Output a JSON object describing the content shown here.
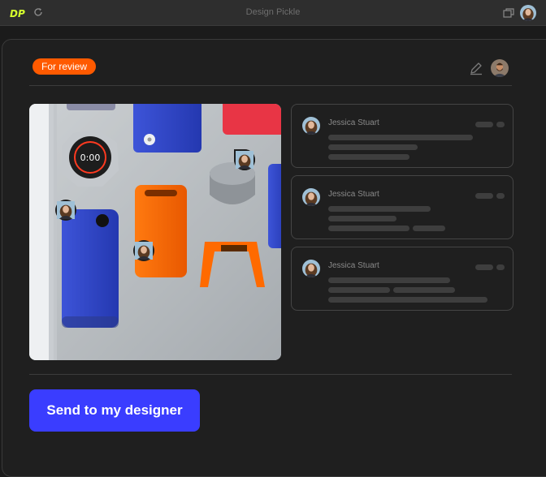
{
  "app": {
    "title": "Design Pickle",
    "logo_icon": "dp-logo-icon"
  },
  "header": {
    "status_badge": "For review"
  },
  "colors": {
    "accent": "#3a3dff",
    "badge": "#ff5a00",
    "brand": "#d6ff2e"
  },
  "comments": [
    {
      "author": "Jessica Stuart"
    },
    {
      "author": "Jessica Stuart"
    },
    {
      "author": "Jessica Stuart"
    }
  ],
  "actions": {
    "send_label": "Send to my designer"
  },
  "image": {
    "timer_text": "0:00"
  }
}
